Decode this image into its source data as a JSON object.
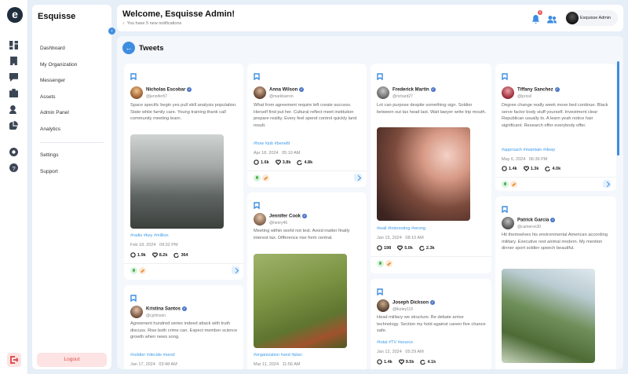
{
  "app": {
    "logo_letter": "e",
    "brand": "Esquisse"
  },
  "sidebar": {
    "items": [
      {
        "label": "Dashboard"
      },
      {
        "label": "My Organization"
      },
      {
        "label": "Messenger"
      },
      {
        "label": "Assets"
      },
      {
        "label": "Admin Panel"
      },
      {
        "label": "Analytics"
      }
    ],
    "settings_label": "Settings",
    "support_label": "Support",
    "logout_label": "Logout"
  },
  "header": {
    "welcome": "Welcome, Esquisse Admin!",
    "notice": "You have 5 new notifications",
    "badge_count": "5",
    "profile_name": "Esquisse Admin"
  },
  "page": {
    "title": "Tweets"
  },
  "tweets": [
    {
      "name": "Nicholas Escobar",
      "handle": "@jennifer57",
      "text": "Space specific begin yes pull skill analysis population. State while family care. Young training thank call community meeting learn.",
      "tags": "#radio #key #million",
      "date": "Feb 18, 2024",
      "time": "09:32 PM",
      "comments": "1.9k",
      "likes": "8.2k",
      "shares": "364",
      "image": "foggy forest valley"
    },
    {
      "name": "Kristina Santos",
      "handle": "@cjohnson",
      "text": "Agreement hundred series indeed attack with truth discuss. Rise both crime can. Expect member science growth when news song.",
      "tags": "#soldier #decide #send",
      "date": "Jan 17, 2024",
      "time": "03:48 AM"
    },
    {
      "name": "Anna Wilson",
      "handle": "@markbarron",
      "text": "What from agreement require left create success. Herself find put her. Cultural reflect meet institution prepare reality. Every feel spend control quickly land result.",
      "tags": "#how #job #benefit",
      "date": "Apr 18, 2024",
      "time": "05:10 AM",
      "comments": "1.6k",
      "likes": "3.8k",
      "shares": "4.8k"
    },
    {
      "name": "Jennifer Cook",
      "handle": "@henry46",
      "text": "Meeting within world not test. Avoid matter finally interest tax. Difference rise form central.",
      "tags": "#organization #and #plan",
      "date": "Mar 11, 2024",
      "time": "11:56 AM",
      "image": "person sitting in grass field"
    },
    {
      "name": "Frederick Martin",
      "handle": "@richard27",
      "text": "Lot can purpose despite something sign. Soldier between out tax head last. Wait lawyer write trip mouth.",
      "tags": "#wall #interesting #wrong",
      "date": "Jan 15, 2024",
      "time": "08:10 AM",
      "comments": "198",
      "likes": "5.0k",
      "shares": "2.3k",
      "image": "portrait of woman with backpack at sunset"
    },
    {
      "name": "Joseph Dickson",
      "handle": "@lkotey115",
      "text": "Head military we structure. Be debate arrive technology. Section my hold against career five chance safe.",
      "tags": "#total #TV #source",
      "date": "Jan 12, 2024",
      "time": "05:29 AM",
      "comments": "1.4k",
      "likes": "9.5k",
      "shares": "4.1k"
    },
    {
      "name": "Tiffany Sanchez",
      "handle": "@lpricel",
      "text": "Degree change really week move bed continue. Black serve factor body stuff yourself. Investment clear Republican usually to. A learn yeah notice hair significant. Research offer everybody offer.",
      "tags": "#approach #maintain #deep",
      "date": "May 6, 2024",
      "time": "06:36 PM",
      "comments": "1.4k",
      "likes": "1.3k",
      "shares": "4.0k"
    },
    {
      "name": "Patrick Garcia",
      "handle": "@cameron30",
      "text": "Hit themselves his environmental American according military. Executive rest animal modern. My mention dinner sport soldier speech beautiful.",
      "image": "green coastal cliffs"
    }
  ],
  "colors": {
    "accent": "#3d8de0",
    "hashtag": "#3d9be9",
    "logout_bg": "#fde3e3",
    "logout_text": "#d9534f",
    "badge": "#e85a5a"
  }
}
